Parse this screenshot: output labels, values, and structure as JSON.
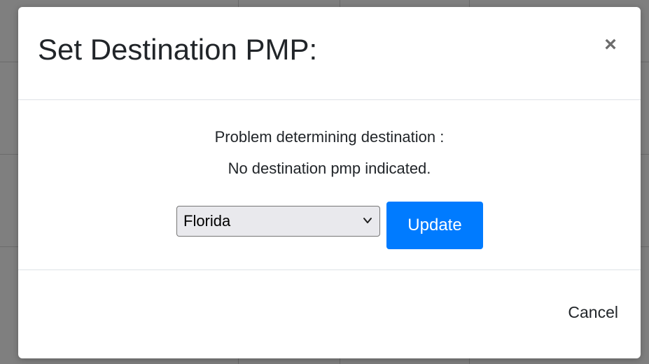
{
  "modal": {
    "title": "Set Destination PMP:",
    "close_label": "×",
    "message_line_1": "Problem determining destination :",
    "message_line_2": "No destination pmp indicated.",
    "destination_select": {
      "selected": "Florida"
    },
    "update_label": "Update",
    "cancel_label": "Cancel"
  },
  "colors": {
    "primary": "#007bff",
    "overlay": "#808080"
  },
  "icons": {
    "close": "close-icon",
    "select": "chevron-down-icon"
  }
}
